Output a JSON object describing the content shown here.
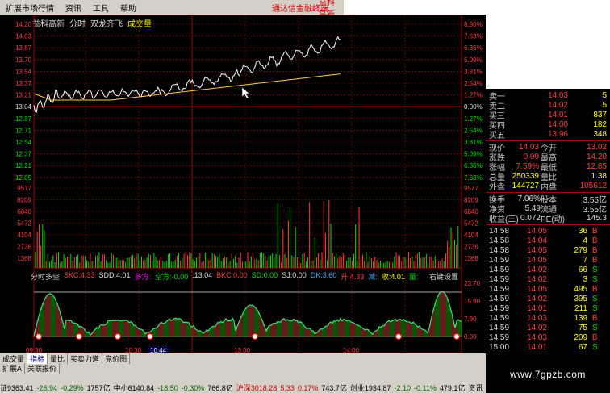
{
  "menu": {
    "items": [
      "扩展市场行情",
      "资讯",
      "工具",
      "帮助"
    ],
    "link1": "通达信金融终端",
    "link2": "益科高新"
  },
  "chart_title": {
    "name": "益科高新",
    "mode": "分时",
    "extra": "双龙齐飞",
    "vol": "成交量"
  },
  "price_ticks": [
    "14.20",
    "14.03",
    "13.87",
    "13.70",
    "13.54",
    "13.37",
    "13.21",
    "13.04",
    "12.87",
    "12.71",
    "12.54",
    "12.37",
    "12.21",
    "12.05"
  ],
  "pct_ticks": [
    "8.90%",
    "7.63%",
    "6.36%",
    "5.09%",
    "3.81%",
    "2.54%",
    "1.27%",
    "0.00%",
    "1.27%",
    "2.54%",
    "3.81%",
    "5.09%",
    "6.36%",
    "7.63%"
  ],
  "vol_ticks": [
    "9577",
    "8209",
    "6840",
    "5472",
    "4104",
    "2736",
    "1368"
  ],
  "ind_ticks": [
    "23.70",
    "15.80",
    "7.90",
    "0.00"
  ],
  "time_ticks": [
    "09:30",
    "10:30",
    "10:44",
    "13:00",
    "14:00"
  ],
  "indicator_header": {
    "name": "分时多空",
    "sk": "SKC:4.33",
    "sdd": "SDD:4.01",
    "duo": "多方:",
    "kong": "空方:-0.00",
    "v13": ":13.04",
    "bk": "BKC:0.00",
    "sd": "SD:0.00",
    "sj": "SJ:0.00",
    "dk": "DK:3.60",
    "sheng": "升:4.33",
    "jian": "减:",
    "shou": "收:4.01",
    "qu": "量:",
    "right": "右键设置"
  },
  "quote": {
    "asks": [
      {
        "l": "卖一",
        "p": "14.03",
        "v": "5"
      },
      {
        "l": "卖二",
        "p": "14.02",
        "v": "5"
      },
      {
        "l": "买三",
        "p": "14.01",
        "v": "837"
      },
      {
        "l": "买四",
        "p": "14.00",
        "v": "182"
      },
      {
        "l": "买五",
        "p": "13.96",
        "v": "348"
      }
    ],
    "stats": [
      {
        "a": "现价",
        "av": "14.03",
        "b": "今开",
        "bv": "13.02"
      },
      {
        "a": "涨跌",
        "av": "0.99",
        "b": "最高",
        "bv": "14.20"
      },
      {
        "a": "涨幅",
        "av": "7.59%",
        "b": "最低",
        "bv": "12.85"
      },
      {
        "a": "总量",
        "av": "250339",
        "b": "量比",
        "bv": "1.38"
      },
      {
        "a": "外盘",
        "av": "144727",
        "b": "内盘",
        "bv": "105612"
      }
    ],
    "stats2": [
      {
        "a": "换手",
        "av": "7.06%",
        "b": "股本",
        "bv": "3.55亿"
      },
      {
        "a": "净资",
        "av": "5.49",
        "b": "流通",
        "bv": "3.55亿"
      },
      {
        "a": "收益(三)",
        "av": "0.072",
        "b": "PE(动)",
        "bv": "145.3"
      }
    ],
    "ticks": [
      {
        "t": "14:58",
        "p": "14.05",
        "v": "36",
        "d": "B"
      },
      {
        "t": "14:58",
        "p": "14.04",
        "v": "4",
        "d": "B"
      },
      {
        "t": "14:58",
        "p": "14.05",
        "v": "279",
        "d": "B"
      },
      {
        "t": "14:59",
        "p": "14.05",
        "v": "7",
        "d": "B"
      },
      {
        "t": "14:59",
        "p": "14.02",
        "v": "66",
        "d": "S"
      },
      {
        "t": "14:59",
        "p": "14.02",
        "v": "3",
        "d": "S"
      },
      {
        "t": "14:59",
        "p": "14.05",
        "v": "495",
        "d": "B"
      },
      {
        "t": "14:59",
        "p": "14.02",
        "v": "395",
        "d": "S"
      },
      {
        "t": "14:59",
        "p": "14.01",
        "v": "211",
        "d": "S"
      },
      {
        "t": "14:59",
        "p": "14.03",
        "v": "139",
        "d": "B"
      },
      {
        "t": "14:59",
        "p": "14.02",
        "v": "75",
        "d": "S"
      },
      {
        "t": "14:59",
        "p": "14.03",
        "v": "209",
        "d": "B"
      },
      {
        "t": "15:00",
        "p": "14.01",
        "v": "67",
        "d": "S"
      }
    ]
  },
  "tabs": [
    "成交量",
    "指标",
    "量比",
    "买卖力道",
    "竞价图"
  ],
  "tabs2": [
    "扩展A",
    "关联报价"
  ],
  "status": {
    "sh": "证9363.41",
    "shc": "-26.94",
    "shp": "-0.29%",
    "sha": "1757亿",
    "zx": "中小6140.84",
    "zxc": "-18.50",
    "zxp": "-0.30%",
    "zxa": "766.8亿",
    "hs": "沪深3018.28",
    "hsc": "5.33",
    "hsp": "0.17%",
    "hsa": "743.7亿",
    "cy": "创业1934.87",
    "cyc": "-2.10",
    "cyp": "-0.11%",
    "cya": "479.1亿",
    "more": "资讯"
  },
  "watermark": "www.7gpzb.com",
  "colors": {
    "up": "#ff4040",
    "down": "#00e000",
    "grid": "#a00000",
    "price_line": "#ffffff",
    "avg_line": "#ffd050"
  }
}
